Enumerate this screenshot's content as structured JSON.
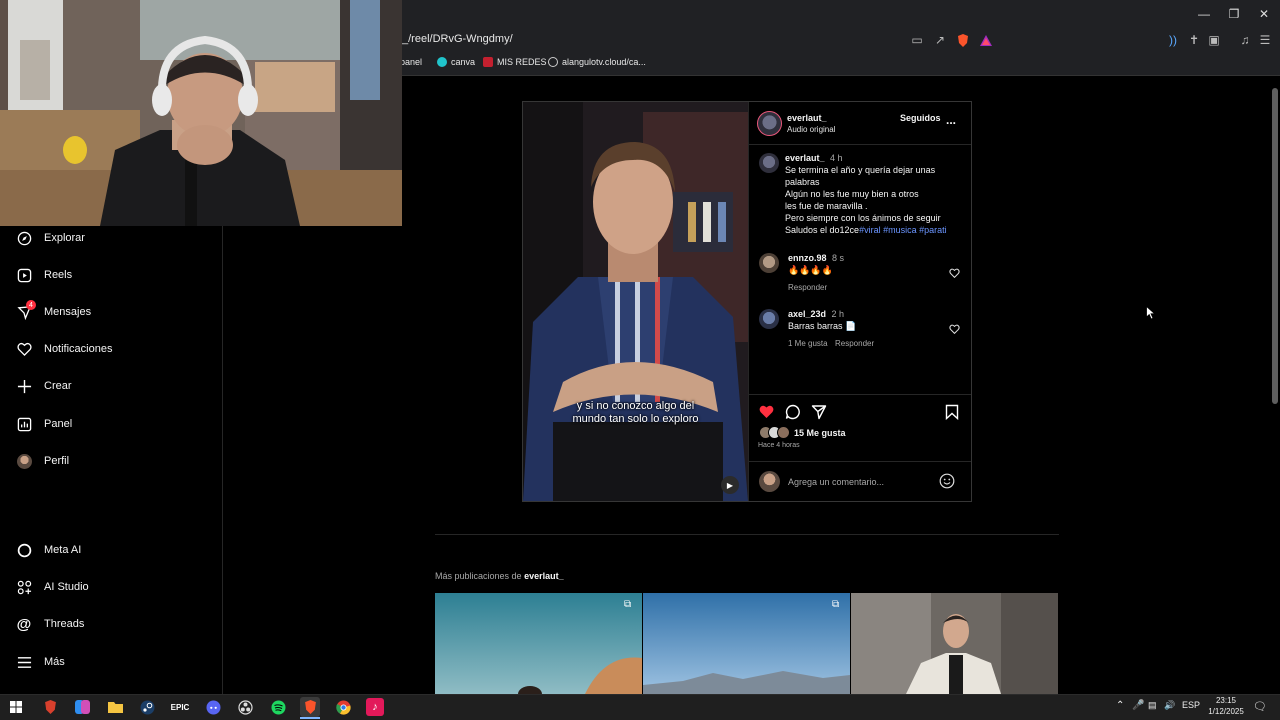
{
  "browser": {
    "url": "_/reel/DRvG-Wngdmy/",
    "bookmarks": [
      "panel",
      "canva",
      "MIS REDES",
      "alangulotv.cloud/ca..."
    ],
    "window_controls": [
      "minimize-icon",
      "restore-icon",
      "close-icon"
    ]
  },
  "sidebar": {
    "items": [
      {
        "label": "Explorar",
        "icon": "compass-icon"
      },
      {
        "label": "Reels",
        "icon": "reels-icon"
      },
      {
        "label": "Mensajes",
        "icon": "messenger-icon",
        "badge": "4"
      },
      {
        "label": "Notificaciones",
        "icon": "heart-icon"
      },
      {
        "label": "Crear",
        "icon": "plus-icon"
      },
      {
        "label": "Panel",
        "icon": "chart-icon"
      },
      {
        "label": "Perfil",
        "icon": "avatar"
      }
    ],
    "bottom_items": [
      {
        "label": "Meta AI",
        "icon": "meta-ai-icon"
      },
      {
        "label": "AI Studio",
        "icon": "ai-studio-icon"
      },
      {
        "label": "Threads",
        "icon": "threads-icon"
      },
      {
        "label": "Más",
        "icon": "menu-icon"
      }
    ]
  },
  "post": {
    "author": "everlaut_",
    "audio": "Audio original",
    "follow_state": "Seguidos",
    "more": "...",
    "subtitle_line1": "y si no conozco algo del",
    "subtitle_line2": "mundo tan solo lo exploro",
    "caption": {
      "author": "everlaut_",
      "time": "4 h",
      "lines": [
        "Se termina el año y quería dejar unas",
        "palabras",
        "Algún no les fue muy bien a otros",
        "les fue de maravilla .",
        "Pero siempre con los ánimos de seguir"
      ],
      "last_line": "Saludos el do12ce",
      "hashtags": "#viral #musica #parati"
    },
    "comments": [
      {
        "user": "ennzo.98",
        "time": "8 s",
        "text": "🔥🔥🔥🔥",
        "likes": "",
        "reply": "Responder"
      },
      {
        "user": "axel_23d",
        "time": "2 h",
        "text": "Barras barras 📄",
        "likes": "1 Me gusta",
        "reply": "Responder"
      }
    ],
    "likes": "15 Me gusta",
    "timestamp": "Hace 4 horas",
    "comment_placeholder": "Agrega un comentario..."
  },
  "more_posts": {
    "prefix": "Más publicaciones de",
    "user": "everlaut_"
  },
  "taskbar": {
    "lang": "ESP",
    "time": "23:15",
    "date": "1/12/2025"
  },
  "colors": {
    "like_red": "#ff3040",
    "hashtag_blue": "#6b95ff",
    "background": "#000000"
  }
}
